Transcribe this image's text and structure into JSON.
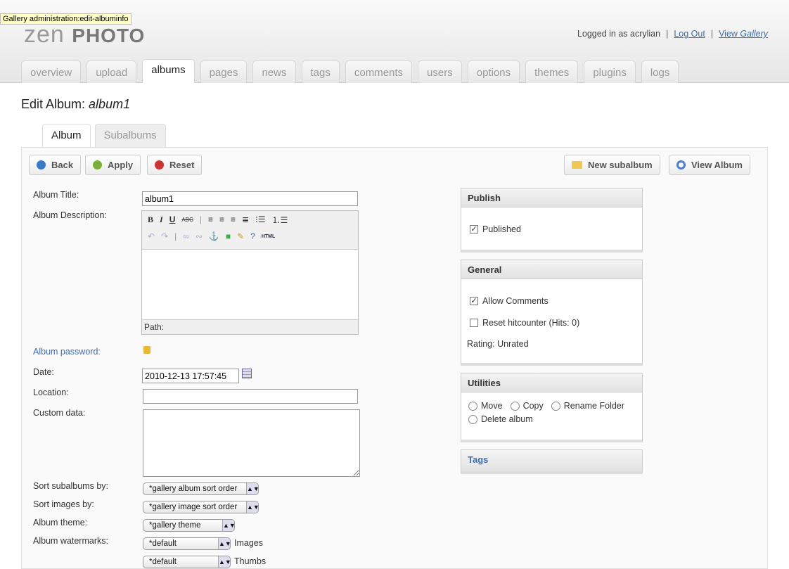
{
  "tooltip": "Gallery administration:edit-albuminfo",
  "logo": {
    "zen": "zen",
    "photo": "PHOTO"
  },
  "user": {
    "logged_in": "Logged in as acrylian",
    "logout": "Log Out",
    "view": "View ",
    "gallery": "Gallery",
    "sep": "|"
  },
  "nav": [
    "overview",
    "upload",
    "albums",
    "pages",
    "news",
    "tags",
    "comments",
    "users",
    "options",
    "themes",
    "plugins",
    "logs"
  ],
  "page_title": {
    "prefix": "Edit Album: ",
    "name": "album1"
  },
  "subtabs": [
    "Album",
    "Subalbums"
  ],
  "buttons": {
    "back": "Back",
    "apply": "Apply",
    "reset": "Reset",
    "new_subalbum": "New subalbum",
    "view_album": "View Album"
  },
  "form": {
    "title_label": "Album Title:",
    "title_value": "album1",
    "desc_label": "Album Description:",
    "editor": {
      "bold": "B",
      "italic": "I",
      "underline": "U",
      "strike": "ABC",
      "html": "HTML",
      "path": "Path:"
    },
    "password_label": "Album password:",
    "date_label": "Date:",
    "date_value": "2010-12-13 17:57:45",
    "location_label": "Location:",
    "location_value": "",
    "custom_label": "Custom data:",
    "sort_sub_label": "Sort subalbums by:",
    "sort_sub_value": "*gallery album sort order",
    "sort_img_label": "Sort images by:",
    "sort_img_value": "*gallery image sort order",
    "theme_label": "Album theme:",
    "theme_value": "*gallery theme",
    "watermark_label": "Album watermarks:",
    "watermark_value": "*default",
    "watermark_images": "Images",
    "watermark_thumbs_value": "*default",
    "watermark_thumbs": "Thumbs"
  },
  "side": {
    "publish": {
      "title": "Publish",
      "published": "Published",
      "published_checked": true
    },
    "general": {
      "title": "General",
      "allow_comments": "Allow Comments",
      "allow_checked": true,
      "reset_hits": "Reset hitcounter (Hits: 0)",
      "reset_checked": false,
      "rating": "Rating: Unrated"
    },
    "utilities": {
      "title": "Utilities",
      "move": "Move",
      "copy": "Copy",
      "rename": "Rename Folder",
      "delete": "Delete album"
    },
    "tags": {
      "title": "Tags"
    }
  }
}
